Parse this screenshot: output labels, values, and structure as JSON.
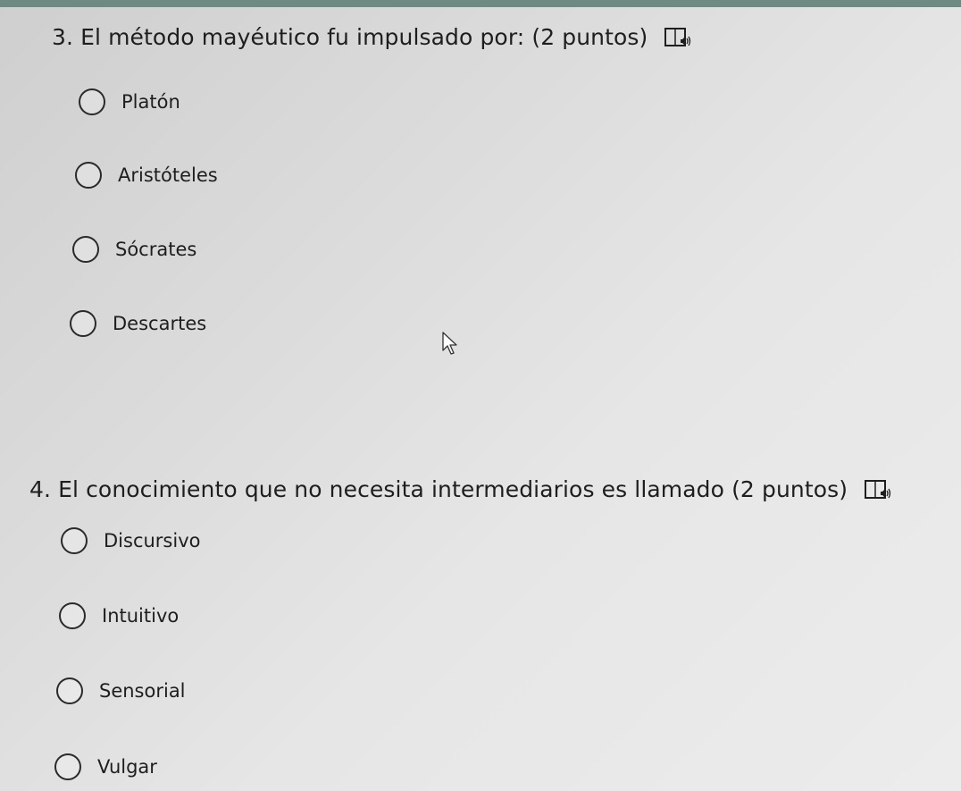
{
  "questions": [
    {
      "title": "3. El método mayéutico fu impulsado por: (2 puntos)",
      "reader_icon": "immersive-reader-icon",
      "options": [
        "Platón",
        "Aristóteles",
        "Sócrates",
        "Descartes"
      ]
    },
    {
      "title": "4. El conocimiento que no necesita intermediarios es llamado  (2 puntos)",
      "reader_icon": "immersive-reader-icon",
      "options": [
        "Discursivo",
        "Intuitivo",
        "Sensorial",
        "Vulgar"
      ]
    }
  ],
  "colors": {
    "top_strip": "#6f8a83",
    "text": "#1e1e1e",
    "radio_border": "#2a2a2a"
  }
}
